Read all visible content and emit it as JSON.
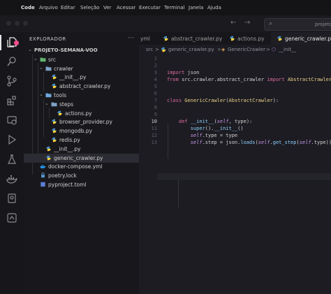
{
  "menubar": {
    "apple": "",
    "items": [
      "Code",
      "Arquivo",
      "Editar",
      "Seleção",
      "Ver",
      "Acessar",
      "Executar",
      "Terminal",
      "Janela",
      "Ajuda"
    ]
  },
  "titlebar": {
    "back": "←",
    "forward": "→",
    "search_text": "projeto"
  },
  "sidebar": {
    "title": "EXPLORADOR",
    "more": "···",
    "tree": [
      {
        "label": "PROJETO-SEMANA-VOO",
        "depth": 0,
        "type": "root",
        "chevron": "⌄"
      },
      {
        "label": "src",
        "depth": 1,
        "type": "folder",
        "chevron": "⌄"
      },
      {
        "label": "crawler",
        "depth": 2,
        "type": "folder",
        "chevron": "⌄"
      },
      {
        "label": "__init__.py",
        "depth": 3,
        "type": "py"
      },
      {
        "label": "abstract_crawler.py",
        "depth": 3,
        "type": "py"
      },
      {
        "label": "tools",
        "depth": 2,
        "type": "folder",
        "chevron": "⌄"
      },
      {
        "label": "steps",
        "depth": 3,
        "type": "folder",
        "chevron": "⌄"
      },
      {
        "label": "actions.py",
        "depth": 4,
        "type": "py"
      },
      {
        "label": "browser_provider.py",
        "depth": 3,
        "type": "py"
      },
      {
        "label": "mongodb.py",
        "depth": 3,
        "type": "py"
      },
      {
        "label": "redis.py",
        "depth": 3,
        "type": "py"
      },
      {
        "label": "__init__.py",
        "depth": 2,
        "type": "py"
      },
      {
        "label": "generic_crawler.py",
        "depth": 2,
        "type": "py",
        "selected": true
      },
      {
        "label": "docker-compose.yml",
        "depth": 1,
        "type": "docker"
      },
      {
        "label": "poetry.lock",
        "depth": 1,
        "type": "lock"
      },
      {
        "label": "pyproject.toml",
        "depth": 1,
        "type": "toml"
      }
    ]
  },
  "tabs": [
    {
      "label": "yml",
      "active": false
    },
    {
      "label": "abstract_crawler.py",
      "active": false
    },
    {
      "label": "actions.py",
      "active": false
    },
    {
      "label": "generic_crawler.py",
      "active": true
    }
  ],
  "breadcrumb": {
    "parts": [
      "src",
      ">",
      "generic_crawler.py",
      ">",
      "GenericCrawler",
      ">",
      "__init__"
    ]
  },
  "editor": {
    "current_line": "10",
    "lines": [
      {
        "n": "1",
        "code": ""
      },
      {
        "n": "2",
        "code": ""
      },
      {
        "n": "3",
        "code": "import json"
      },
      {
        "n": "4",
        "code": "from src.crawler.abstract_crawler import AbstractCrawler"
      },
      {
        "n": "5",
        "code": ""
      },
      {
        "n": "6",
        "code": ""
      },
      {
        "n": "7",
        "code": "class GenericCrawler(AbstractCrawler):"
      },
      {
        "n": "8",
        "code": ""
      },
      {
        "n": "9",
        "code": ""
      },
      {
        "n": "10",
        "code": "    def __init__(self, type):"
      },
      {
        "n": "11",
        "code": "        super().__init__()"
      },
      {
        "n": "12",
        "code": "        self.type = type"
      },
      {
        "n": "13",
        "code": "        self.step = json.loads(self.get_step(self.type))"
      }
    ]
  },
  "colors": {
    "accent": "#e44b8d",
    "keyword": "#e06c9f",
    "class": "#f0d48a",
    "self": "#c795e6"
  }
}
